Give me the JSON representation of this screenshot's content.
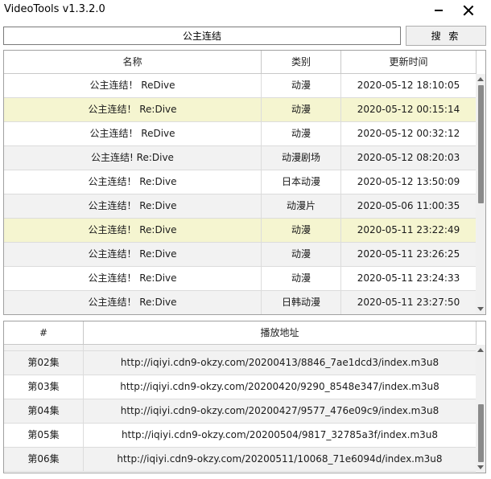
{
  "window": {
    "title": "VideoTools v1.3.2.0"
  },
  "search": {
    "value": "公主连结",
    "button_label": "搜 索"
  },
  "results_table": {
    "columns": [
      "名称",
      "类别",
      "更新时间"
    ],
    "rows": [
      {
        "name": "公主连结！ ReDive",
        "category": "动漫",
        "updated": "2020-05-12 18:10:05"
      },
      {
        "name": "公主连结！ Re:Dive",
        "category": "动漫",
        "updated": "2020-05-12 00:15:14"
      },
      {
        "name": "公主连结！ ReDive",
        "category": "动漫",
        "updated": "2020-05-12 00:32:12"
      },
      {
        "name": "公主连结! Re:Dive",
        "category": "动漫剧场",
        "updated": "2020-05-12 08:20:03"
      },
      {
        "name": "公主连结！ Re:Dive",
        "category": "日本动漫",
        "updated": "2020-05-12 13:50:09"
      },
      {
        "name": "公主连结！ Re:Dive",
        "category": "动漫片",
        "updated": "2020-05-06 11:00:35"
      },
      {
        "name": "公主连结！ Re:Dive",
        "category": "动漫",
        "updated": "2020-05-11 23:22:49"
      },
      {
        "name": "公主连结！ Re:Dive",
        "category": "动漫",
        "updated": "2020-05-11 23:26:25"
      },
      {
        "name": "公主连结！ Re:Dive",
        "category": "动漫",
        "updated": "2020-05-11 23:24:33"
      },
      {
        "name": "公主连结！ Re:Dive",
        "category": "日韩动漫",
        "updated": "2020-05-11 23:27:50"
      }
    ]
  },
  "episodes_table": {
    "columns": [
      "#",
      "播放地址"
    ],
    "rows": [
      {
        "episode": "第02集",
        "url": "http://iqiyi.cdn9-okzy.com/20200413/8846_7ae1dcd3/index.m3u8"
      },
      {
        "episode": "第03集",
        "url": "http://iqiyi.cdn9-okzy.com/20200420/9290_8548e347/index.m3u8"
      },
      {
        "episode": "第04集",
        "url": "http://iqiyi.cdn9-okzy.com/20200427/9577_476e09c9/index.m3u8"
      },
      {
        "episode": "第05集",
        "url": "http://iqiyi.cdn9-okzy.com/20200504/9817_32785a3f/index.m3u8"
      },
      {
        "episode": "第06集",
        "url": "http://iqiyi.cdn9-okzy.com/20200511/10068_71e6094d/index.m3u8"
      }
    ]
  },
  "colors": {
    "highlight_row": "#f5f5d0",
    "alt_row": "#f2f2f2",
    "border": "#a0a0a0"
  },
  "icons": [
    "minimize-icon",
    "close-icon",
    "scroll-up-arrow-icon",
    "scroll-down-arrow-icon"
  ]
}
